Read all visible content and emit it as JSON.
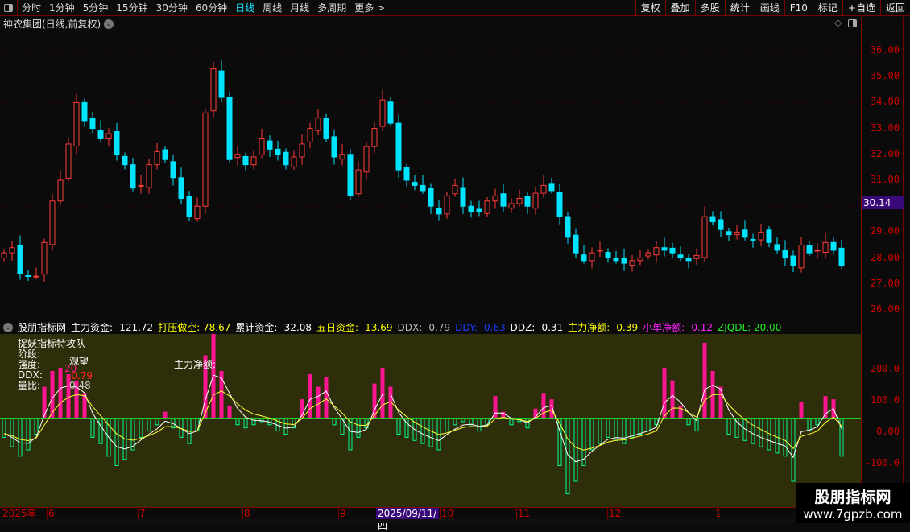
{
  "toolbar": {
    "periods": [
      "分时",
      "1分钟",
      "5分钟",
      "15分钟",
      "30分钟",
      "60分钟",
      "日线",
      "周线",
      "月线",
      "多周期",
      "更多 >"
    ],
    "active_period": "日线",
    "buttons": [
      "复权",
      "叠加",
      "多股",
      "统计",
      "画线",
      "F10",
      "标记",
      "+自选",
      "返回"
    ]
  },
  "chart": {
    "title": "神农集团(日线,前复权)",
    "price_ticks": [
      "36.00",
      "35.00",
      "34.00",
      "33.00",
      "32.00",
      "31.00",
      "30.00",
      "29.00",
      "28.00",
      "27.00",
      "26.00"
    ],
    "current_price": "30.14",
    "up_color": "#ff3b3b",
    "down_color": "#00e5ff",
    "closes": [
      28.2,
      28.4,
      27.4,
      27.3,
      27.3,
      28.6,
      30.2,
      31.0,
      32.4,
      34.0,
      33.3,
      33.0,
      32.6,
      32.8,
      32.0,
      31.6,
      30.7,
      30.8,
      31.6,
      32.1,
      31.8,
      31.1,
      30.3,
      29.6,
      30.0,
      33.6,
      35.3,
      34.2,
      31.8,
      32.0,
      31.6,
      31.9,
      32.6,
      32.2,
      32.0,
      31.6,
      31.9,
      32.4,
      33.0,
      33.4,
      32.6,
      31.9,
      32.0,
      30.4,
      31.4,
      32.3,
      33.0,
      34.1,
      33.2,
      31.4,
      31.0,
      30.8,
      30.6,
      30.0,
      29.7,
      30.4,
      30.8,
      30.0,
      29.8,
      29.8,
      30.2,
      30.4,
      30.0,
      30.1,
      30.3,
      30.0,
      30.5,
      30.8,
      30.6,
      29.6,
      28.8,
      28.2,
      27.9,
      28.2,
      28.3,
      28.0,
      27.9,
      27.8,
      27.9,
      28.0,
      28.2,
      28.4,
      28.3,
      28.2,
      28.0,
      27.9,
      28.1,
      29.6,
      29.4,
      29.1,
      28.9,
      29.0,
      28.8,
      28.7,
      29.0,
      28.6,
      28.3,
      28.0,
      27.7,
      28.5,
      28.2,
      28.3,
      28.6,
      28.3,
      27.7
    ]
  },
  "indicator": {
    "name": "股朋指标网",
    "items": [
      {
        "label": "主力资金:",
        "value": "-121.72",
        "color": "#ffffff"
      },
      {
        "label": "打压做空:",
        "value": "78.67",
        "color": "#ffff00"
      },
      {
        "label": "累计资金:",
        "value": "-32.08",
        "color": "#ffffff"
      },
      {
        "label": "五日资金:",
        "value": "-13.69",
        "color": "#ffff00"
      },
      {
        "label": "DDX:",
        "value": "-0.79",
        "color": "#bbbbbb"
      },
      {
        "label": "DDY:",
        "value": "-0.63",
        "color": "#1a3cff"
      },
      {
        "label": "DDZ:",
        "value": "-0.31",
        "color": "#ffffff"
      },
      {
        "label": "主力净额:",
        "value": "-0.39",
        "color": "#ffff00"
      },
      {
        "label": "小单净额:",
        "value": "-0.12",
        "color": "#ff22ff"
      },
      {
        "label": "ZJQDL:",
        "value": "20.00",
        "color": "#22ee22"
      }
    ],
    "panel_labels": {
      "title": "捉妖指标特攻队",
      "stage": "阶段:",
      "strength": "强度:",
      "ddx": "DDX:",
      "volume_ratio": "量比:",
      "stage_value": "观望",
      "strength_value": "20",
      "ddx_value": "-0.79",
      "volume_ratio_value": "0.48",
      "net_label": "主力净额:"
    },
    "ticks": [
      "200.0",
      "100.0",
      "0.00",
      "-100.0"
    ],
    "pos_color": "#ff1493",
    "neg_color": "#00ff99",
    "histogram": [
      -60,
      -90,
      -120,
      -100,
      -50,
      100,
      150,
      160,
      140,
      120,
      80,
      -60,
      -80,
      -120,
      -150,
      -130,
      -100,
      -60,
      -40,
      -20,
      20,
      -30,
      -60,
      -80,
      -40,
      200,
      270,
      150,
      40,
      -20,
      -30,
      -20,
      -10,
      -20,
      -40,
      -50,
      -30,
      60,
      140,
      100,
      130,
      -20,
      -50,
      -100,
      -60,
      -30,
      110,
      160,
      100,
      -50,
      -60,
      -70,
      -80,
      -90,
      -100,
      -40,
      -20,
      -10,
      -20,
      -40,
      -20,
      70,
      20,
      -20,
      -10,
      -30,
      30,
      80,
      60,
      -150,
      -240,
      -200,
      -150,
      -100,
      -80,
      -60,
      -70,
      -80,
      -60,
      -50,
      -40,
      -20,
      160,
      120,
      40,
      -20,
      -40,
      240,
      150,
      100,
      -50,
      -60,
      -70,
      -80,
      -90,
      -100,
      -110,
      -120,
      -200,
      50,
      -40,
      -20,
      70,
      60,
      -120
    ]
  },
  "date_axis": {
    "labels": [
      "2025年",
      "6",
      "7",
      "8",
      "9",
      "10",
      "11",
      "12",
      "1"
    ],
    "cursor": "2025/09/11/四"
  },
  "watermark": {
    "line1": "股朋指标网",
    "line2": "www.7gpzb.com"
  }
}
